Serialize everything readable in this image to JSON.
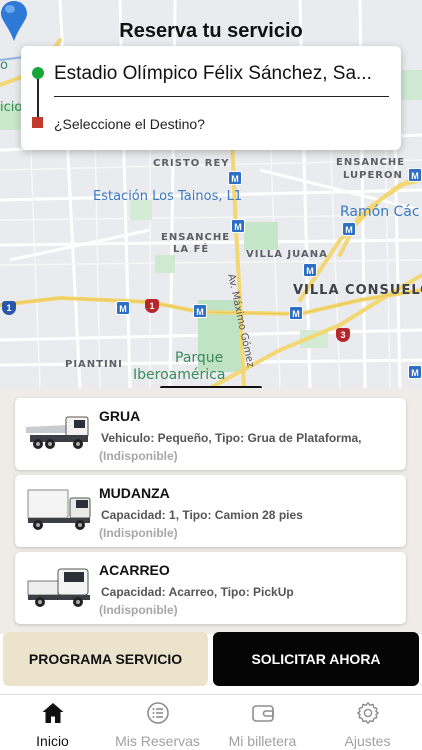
{
  "header": {
    "title": "Reserva tu servicio"
  },
  "route": {
    "origin": "Estadio Olímpico Félix Sánchez, Sa...",
    "destination_placeholder": "¿Seleccione el Destino?"
  },
  "map": {
    "labels": {
      "cristo_rey": "CRISTO REY",
      "ensanche_luperon": [
        "ENSANCHE",
        "LUPERON"
      ],
      "estacion": "Estación Los Tainos, L1",
      "ramon": "Ramón Các",
      "ensanche_la_fe": [
        "ENSANCHE",
        "LA FÉ"
      ],
      "villa_juana": "VILLA JUANA",
      "villa_consuelo": "VILLA CONSUELO",
      "piantini": "PIANTINI",
      "parque": [
        "Parque",
        "Iberoamérica"
      ],
      "av_maximo_gomez": "Av. Máximo Gómez",
      "left_edge": [
        "o",
        "icio"
      ]
    },
    "metro_badge": "M",
    "highway_badges": [
      "1",
      "1",
      "3"
    ]
  },
  "services": [
    {
      "title": "GRUA",
      "description": "Vehiculo: Pequeño, Tipo: Grua de Plataforma,",
      "status": "(Indisponible)",
      "icon": "tow-truck-icon"
    },
    {
      "title": "MUDANZA",
      "description": "Capacidad: 1, Tipo: Camion 28 pies",
      "status": "(Indisponible)",
      "icon": "box-truck-icon"
    },
    {
      "title": "ACARREO",
      "description": "Capacidad: Acarreo, Tipo: PickUp",
      "status": "(Indisponible)",
      "icon": "pickup-truck-icon"
    }
  ],
  "actions": {
    "schedule": "PROGRAMA SERVICIO",
    "request": "SOLICITAR AHORA"
  },
  "tabs": [
    {
      "label": "Inicio",
      "icon": "home-icon",
      "active": true
    },
    {
      "label": "Mis Reservas",
      "icon": "list-icon",
      "active": false
    },
    {
      "label": "Mi billetera",
      "icon": "wallet-icon",
      "active": false
    },
    {
      "label": "Ajustes",
      "icon": "gear-icon",
      "active": false
    }
  ],
  "colors": {
    "origin_marker": "#17a63a",
    "destination_marker": "#c0392b",
    "metro": "#2c6fc4",
    "pin": "#2d79d6",
    "schedule_button": "#ece3cc",
    "request_button": "#050505",
    "list_background": "#efebe7"
  }
}
